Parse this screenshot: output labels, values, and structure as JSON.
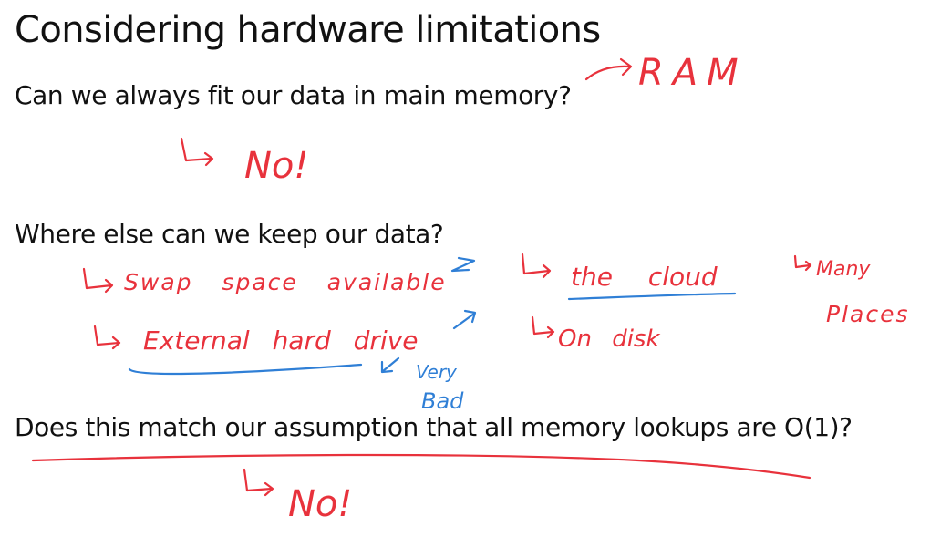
{
  "slide": {
    "title": "Considering hardware limitations",
    "question1": "Can we always fit our data in main memory?",
    "question2": "Where else can we keep our data?",
    "question3": "Does this match our assumption that all memory lookups are O(1)?"
  },
  "annotations": {
    "ram": "RAM",
    "no1": "No!",
    "swap_space": "Swap space available",
    "the_cloud": "the cloud",
    "many_places_1": "Many",
    "many_places_2": "Places",
    "external_drive": "External hard drive",
    "on_disk": "On disk",
    "very_bad_1": "Very",
    "very_bad_2": "Bad",
    "no2": "No!"
  },
  "colors": {
    "red_ink": "#e8323c",
    "blue_ink": "#2f7fd6",
    "text": "#111111"
  }
}
